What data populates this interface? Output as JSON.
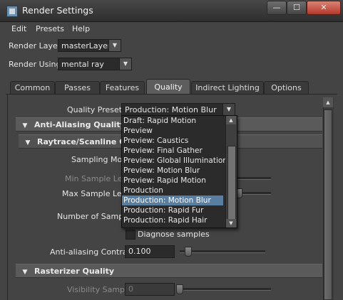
{
  "window": {
    "title": "Render Settings",
    "min_glyph": "—",
    "max_glyph": "☐",
    "close_glyph": "✕"
  },
  "menu": {
    "items": [
      "Edit",
      "Presets",
      "Help"
    ]
  },
  "render_layer": {
    "label": "Render Layer",
    "value": "masterLayer"
  },
  "render_using": {
    "label": "Render Using",
    "value": "mental ray"
  },
  "tabs": [
    {
      "label": "Common",
      "active": false
    },
    {
      "label": "Passes",
      "active": false
    },
    {
      "label": "Features",
      "active": false
    },
    {
      "label": "Quality",
      "active": true
    },
    {
      "label": "Indirect Lighting",
      "active": false
    },
    {
      "label": "Options",
      "active": false
    }
  ],
  "quality_presets": {
    "label": "Quality Presets",
    "value": "Production: Motion Blur",
    "options": [
      "Draft: Rapid Motion",
      "Preview",
      "Preview: Caustics",
      "Preview: Final Gather",
      "Preview: Global Illumination",
      "Preview: Motion Blur",
      "Preview: Rapid Motion",
      "Production",
      "Production: Motion Blur",
      "Production: Rapid Fur",
      "Production: Rapid Hair"
    ],
    "selected_index": 8
  },
  "sections": {
    "anti_aliasing": "Anti-Aliasing Quality",
    "raytrace": "Raytrace/Scanline Q",
    "rasterizer": "Rasterizer Quality"
  },
  "fields": {
    "sampling_mode": "Sampling Mode",
    "min_sample_level": "Min Sample Level",
    "max_sample_level": "Max Sample Level",
    "number_of_samples": "Number of Samples",
    "diagnose_samples": "Diagnose samples",
    "anti_aliasing_contrast": {
      "label": "Anti-aliasing Contrast",
      "value": "0.100"
    },
    "visibility_samples": {
      "label": "Visibility Samples",
      "value": "0"
    }
  },
  "icons": {
    "expand": "▼",
    "arrow_up": "▲",
    "arrow_down": "▼"
  },
  "colors": {
    "selection": "#5a7ea0",
    "close_button": "#b5372a"
  }
}
